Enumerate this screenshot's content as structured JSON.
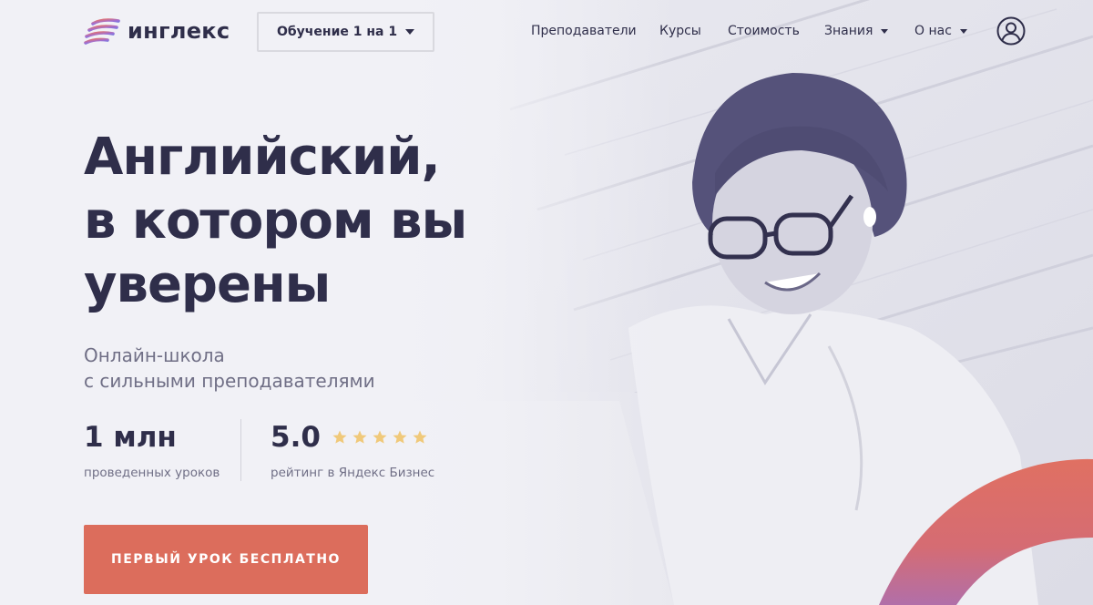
{
  "header": {
    "logo_text": "инглекс",
    "course_select": {
      "value": "Обучение 1 на 1"
    },
    "nav": [
      {
        "label": "Преподаватели",
        "has_dropdown": false
      },
      {
        "label": "Курсы",
        "has_dropdown": false
      },
      {
        "label": "Стоимость",
        "has_dropdown": false
      },
      {
        "label": "Знания",
        "has_dropdown": true
      },
      {
        "label": "О нас",
        "has_dropdown": true
      }
    ],
    "profile_icon": "user-circle-icon"
  },
  "hero": {
    "headline_lines": [
      "Английский,",
      "в котором вы",
      "уверены"
    ],
    "subtitle_lines": [
      "Онлайн-школа",
      "с сильными преподавателями"
    ],
    "stats": [
      {
        "value": "1 млн",
        "label": "проведенных уроков"
      },
      {
        "value": "5.0",
        "label": "рейтинг в Яндекс Бизнес",
        "stars": 5
      }
    ],
    "cta_label": "ПЕРВЫЙ УРОК БЕСПЛАТНО"
  },
  "colors": {
    "background": "#f1f1f6",
    "text_dark": "#2f2e4a",
    "text_muted": "#706f86",
    "accent": "#dc6d5c",
    "star": "#f0c97a",
    "logo_gradient": [
      "#e8706a",
      "#9c6fd6",
      "#5c7be0"
    ]
  }
}
